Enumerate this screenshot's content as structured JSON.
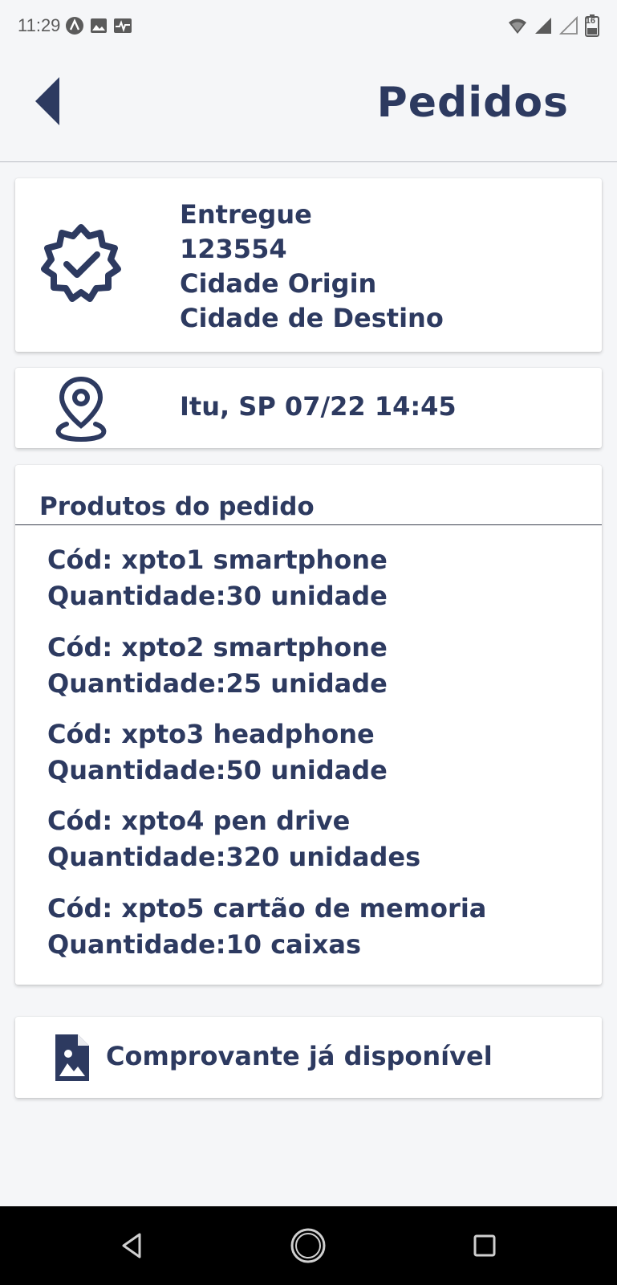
{
  "status_bar": {
    "time": "11:29",
    "icons": [
      "app-notification-icon",
      "image-icon",
      "activity-icon"
    ],
    "battery_level": "16",
    "right_icons": [
      "wifi-icon",
      "signal-icon",
      "signal-empty-icon",
      "battery-icon"
    ]
  },
  "header": {
    "title": "Pedidos",
    "back_icon": "back-arrow-icon"
  },
  "order": {
    "status": "Entregue",
    "number": "123554",
    "origin": "Cidade Origin",
    "destination": "Cidade de Destino",
    "status_icon": "verified-badge-icon"
  },
  "location": {
    "icon": "map-pin-icon",
    "text": "Itu, SP 07/22 14:45"
  },
  "products": {
    "title": "Produtos do pedido",
    "items": [
      {
        "code": "Cód: xpto1 smartphone",
        "quantity": "Quantidade:30 unidade"
      },
      {
        "code": "Cód: xpto2 smartphone",
        "quantity": "Quantidade:25 unidade"
      },
      {
        "code": "Cód: xpto3 headphone",
        "quantity": "Quantidade:50 unidade"
      },
      {
        "code": "Cód: xpto4 pen drive",
        "quantity": "Quantidade:320 unidades"
      },
      {
        "code": "Cód: xpto5 cartão de memoria",
        "quantity": "Quantidade:10 caixas"
      }
    ]
  },
  "receipt": {
    "icon": "document-image-icon",
    "label": "Comprovante já disponível"
  },
  "nav": {
    "buttons": [
      "nav-back-icon",
      "nav-home-icon",
      "nav-recents-icon"
    ]
  },
  "colors": {
    "primary": "#2d3a60",
    "background": "#f5f6f8",
    "card": "#ffffff",
    "nav_bar": "#000000"
  }
}
